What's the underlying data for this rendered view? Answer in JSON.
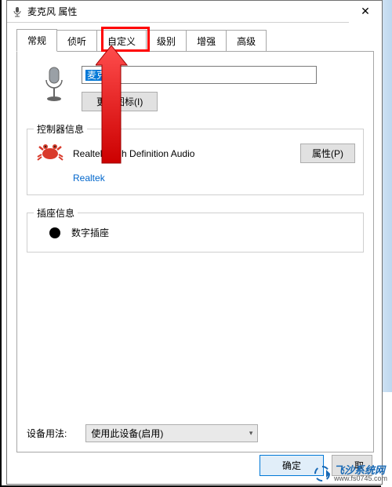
{
  "titlebar": {
    "title": "麦克风 属性"
  },
  "tabs": {
    "general": "常规",
    "listen": "侦听",
    "custom": "自定义",
    "levels": "级别",
    "enhance": "增强",
    "advanced": "高级"
  },
  "device": {
    "name": "麦克风",
    "change_icon_btn": "更改图标(I)"
  },
  "controller": {
    "legend": "控制器信息",
    "name": "Realtek High Definition Audio",
    "vendor": "Realtek",
    "props_btn": "属性(P)"
  },
  "jack": {
    "legend": "插座信息",
    "label": "数字插座"
  },
  "usage": {
    "label": "设备用法:",
    "selected": "使用此设备(启用)"
  },
  "buttons": {
    "ok": "确定",
    "cancel_cut": "取"
  },
  "watermark": {
    "line1": "飞沙系统网",
    "line2": "www.fs0745.com"
  }
}
